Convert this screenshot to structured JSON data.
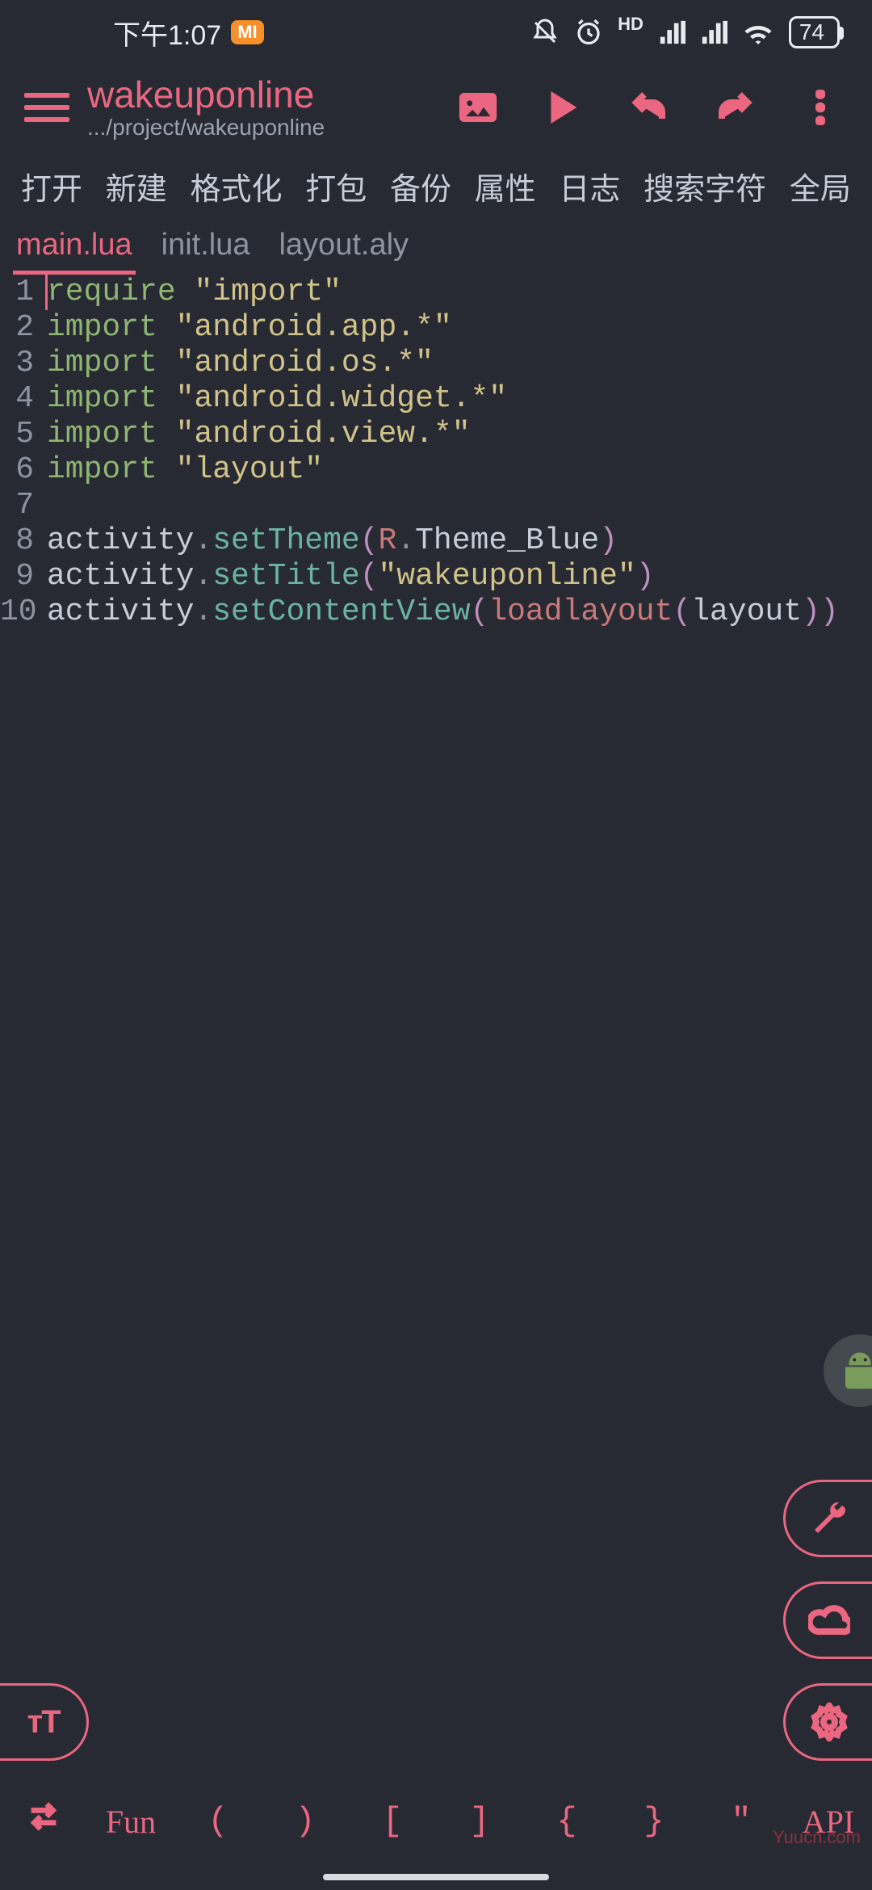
{
  "status": {
    "time": "下午1:07",
    "mi": "MI",
    "hd": "HD",
    "battery": "74"
  },
  "header": {
    "title": "wakeuponline",
    "subtitle": ".../project/wakeuponline"
  },
  "toolbar": [
    "打开",
    "新建",
    "格式化",
    "打包",
    "备份",
    "属性",
    "日志",
    "搜索字符",
    "全局"
  ],
  "tabs": [
    {
      "label": "main.lua",
      "active": true
    },
    {
      "label": "init.lua",
      "active": false
    },
    {
      "label": "layout.aly",
      "active": false
    }
  ],
  "code_lines": [
    {
      "n": "1",
      "t": [
        [
          "kw",
          "require"
        ],
        [
          "id",
          " "
        ],
        [
          "str",
          "\"import\""
        ]
      ]
    },
    {
      "n": "2",
      "t": [
        [
          "kw",
          "import"
        ],
        [
          "id",
          " "
        ],
        [
          "str",
          "\"android.app.*\""
        ]
      ]
    },
    {
      "n": "3",
      "t": [
        [
          "kw",
          "import"
        ],
        [
          "id",
          " "
        ],
        [
          "str",
          "\"android.os.*\""
        ]
      ]
    },
    {
      "n": "4",
      "t": [
        [
          "kw",
          "import"
        ],
        [
          "id",
          " "
        ],
        [
          "str",
          "\"android.widget.*\""
        ]
      ]
    },
    {
      "n": "5",
      "t": [
        [
          "kw",
          "import"
        ],
        [
          "id",
          " "
        ],
        [
          "str",
          "\"android.view.*\""
        ]
      ]
    },
    {
      "n": "6",
      "t": [
        [
          "kw",
          "import"
        ],
        [
          "id",
          " "
        ],
        [
          "str",
          "\"layout\""
        ]
      ]
    },
    {
      "n": "7",
      "t": []
    },
    {
      "n": "8",
      "t": [
        [
          "id",
          "activity"
        ],
        [
          "op",
          "."
        ],
        [
          "fn",
          "setTheme"
        ],
        [
          "paren",
          "("
        ],
        [
          "glob",
          "R"
        ],
        [
          "op",
          "."
        ],
        [
          "id",
          "Theme_Blue"
        ],
        [
          "paren",
          ")"
        ]
      ]
    },
    {
      "n": "9",
      "t": [
        [
          "id",
          "activity"
        ],
        [
          "op",
          "."
        ],
        [
          "fn",
          "setTitle"
        ],
        [
          "paren",
          "("
        ],
        [
          "str",
          "\"wakeuponline\""
        ],
        [
          "paren",
          ")"
        ]
      ]
    },
    {
      "n": "10",
      "t": [
        [
          "id",
          "activity"
        ],
        [
          "op",
          "."
        ],
        [
          "fn",
          "setContentView"
        ],
        [
          "paren",
          "("
        ],
        [
          "glob",
          "loadlayout"
        ],
        [
          "paren2",
          "("
        ],
        [
          "id",
          "layout"
        ],
        [
          "paren2",
          ")"
        ],
        [
          "paren",
          ")"
        ]
      ]
    }
  ],
  "text_size_label": "тT",
  "bottom_bar": {
    "fun": "Fun",
    "lparen": "(",
    "rparen": ")",
    "lbrack": "[",
    "rbrack": "]",
    "lbrace": "{",
    "rbrace": "}",
    "quote": "\"",
    "api": "API"
  },
  "watermark": "Yuucn.com"
}
